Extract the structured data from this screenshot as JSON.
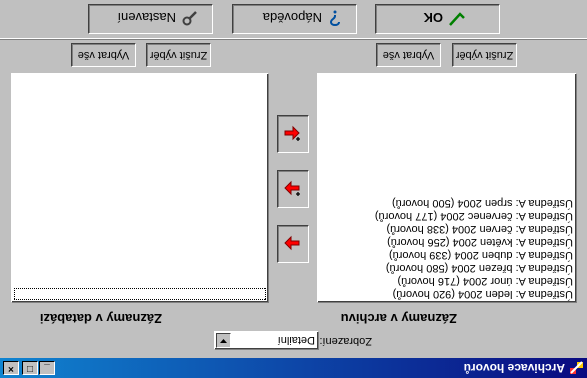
{
  "window": {
    "title": "Archivace hovorů",
    "controls": {
      "minimize": "_",
      "maximize": "□",
      "close": "×"
    }
  },
  "view": {
    "label": "Zobrazení:",
    "value": "Detailní"
  },
  "panels": {
    "database": {
      "label": "Záznamy v databázi",
      "select_all": "Vybrat vše",
      "deselect": "Zrušit výběr",
      "items": []
    },
    "archive": {
      "label": "Záznamy v archivu",
      "select_all": "Vybrat vše",
      "deselect": "Zrušit výběr",
      "items": [
        "Ústředna A: leden 2004 (920 hovorů)",
        "Ústředna A: únor 2004 (716 hovorů)",
        "Ústředna A: březen 2004 (580 hovorů)",
        "Ústředna A: duben 2004 (339 hovorů)",
        "Ústředna A: květen 2004 (256 hovorů)",
        "Ústředna A: červen 2004 (338 hovorů)",
        "Ústředna A: červenec 2004 (177 hovorů)",
        "Ústředna A: srpen 2004 (500 hovorů)"
      ]
    }
  },
  "transfer": {
    "icons": [
      "arrow-right-icon",
      "arrow-right-plus-icon",
      "arrow-left-plus-icon"
    ],
    "arrow_color": "#ff0000"
  },
  "footer_buttons": {
    "settings": "Nastavení",
    "help": "Nápověda",
    "ok": "OK"
  }
}
